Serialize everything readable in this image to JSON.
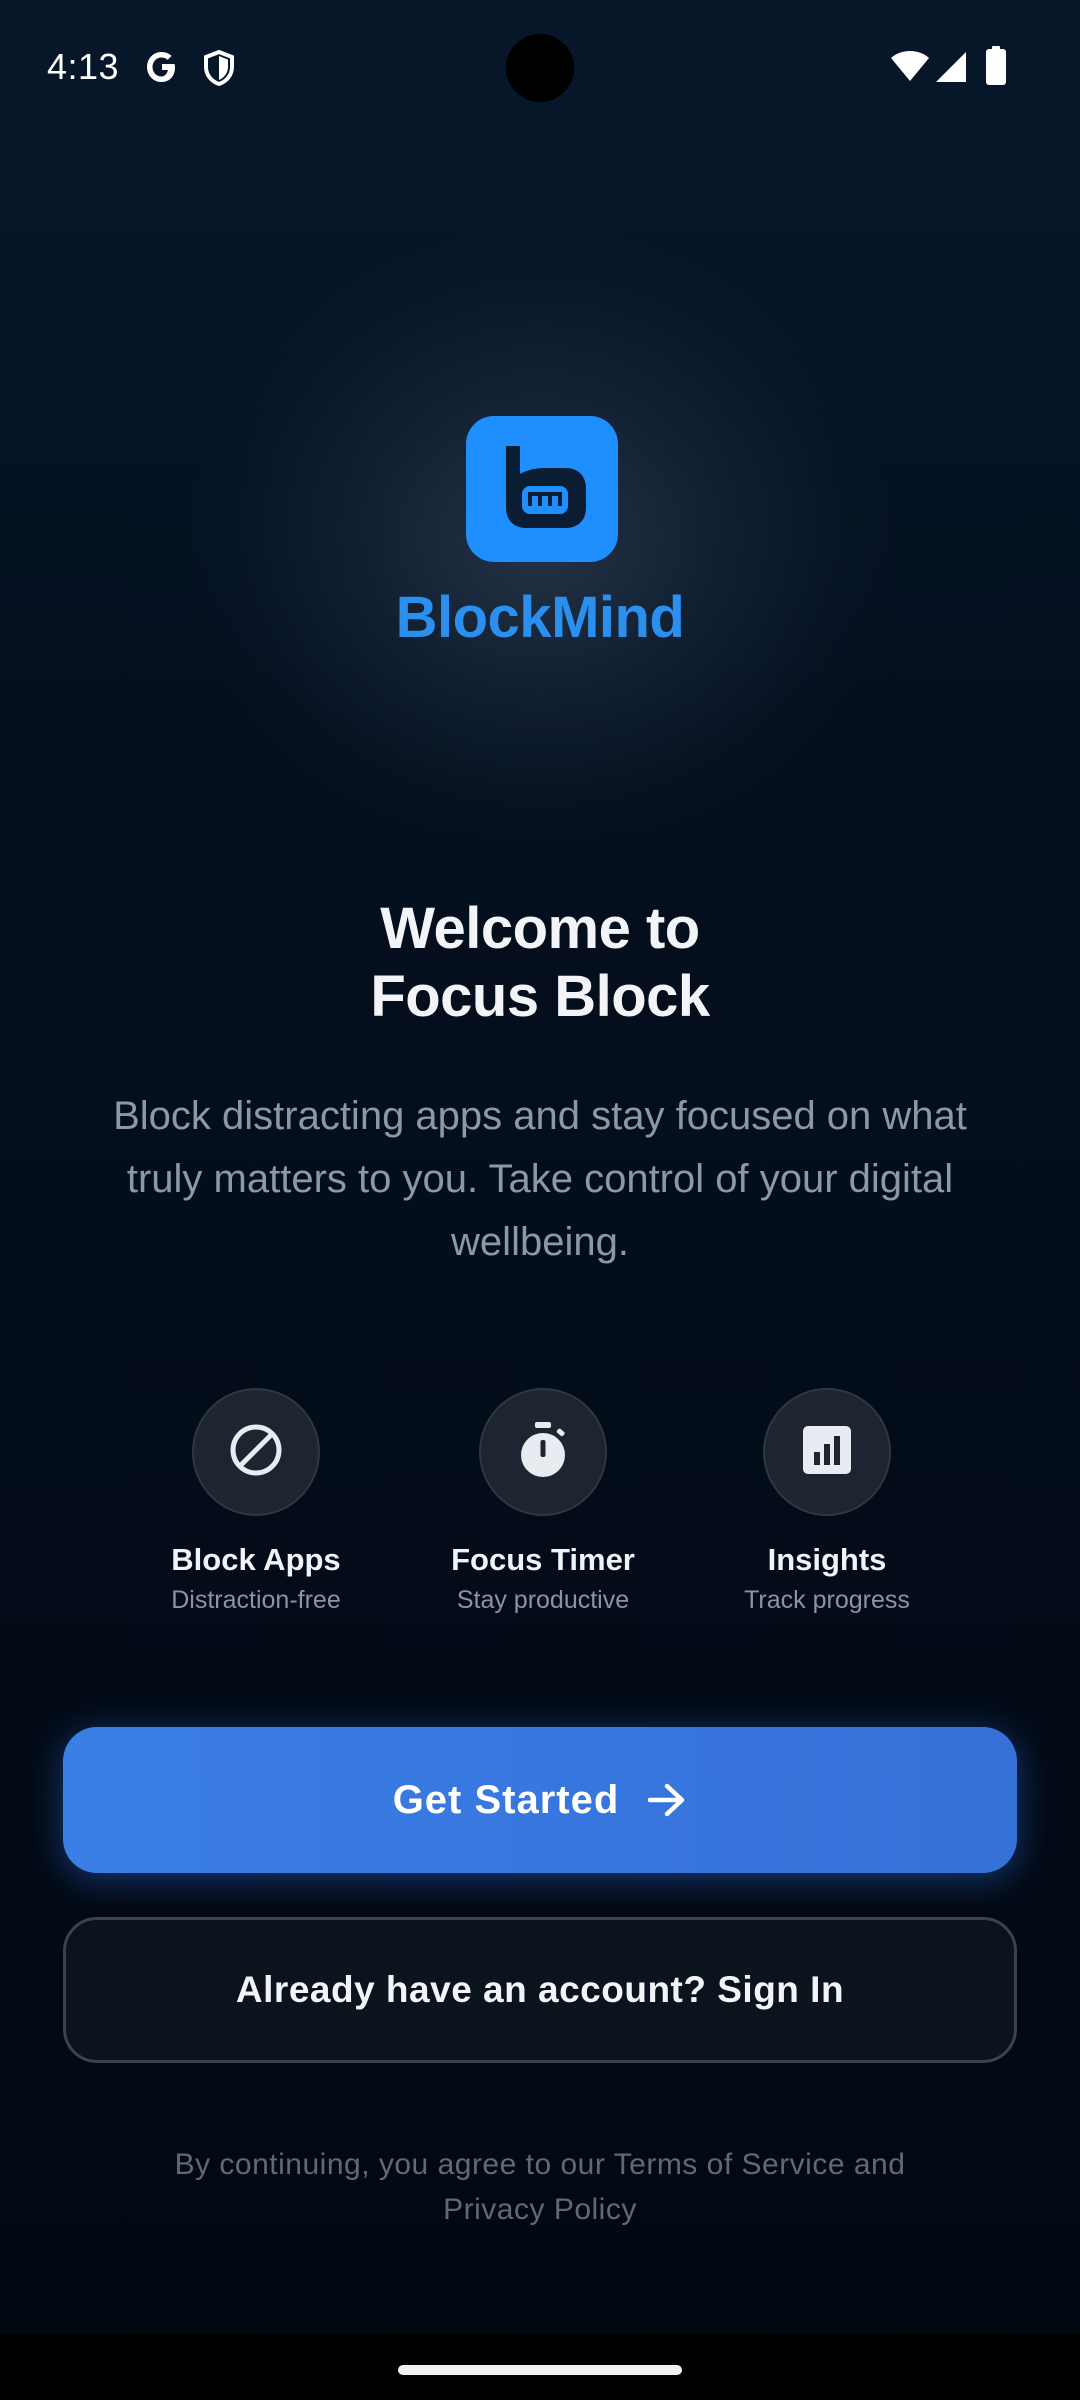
{
  "status_bar": {
    "time": "4:13",
    "left_icons": [
      "google-icon",
      "shield-icon"
    ],
    "right_icons": [
      "wifi-icon",
      "cellular-signal-icon",
      "battery-icon"
    ]
  },
  "logo": {
    "wordmark": "BlockMind",
    "tile_color": "#1f8fff",
    "wordmark_color": "#2b8ff0"
  },
  "welcome": {
    "title_line1": "Welcome to",
    "title_line2": "Focus Block",
    "description": "Block distracting apps and stay focused on what truly matters to you. Take control of your digital wellbeing."
  },
  "features": [
    {
      "icon": "block-icon",
      "title": "Block Apps",
      "subtitle": "Distraction-free"
    },
    {
      "icon": "timer-icon",
      "title": "Focus Timer",
      "subtitle": "Stay productive"
    },
    {
      "icon": "insights-chart-icon",
      "title": "Insights",
      "subtitle": "Track progress"
    }
  ],
  "buttons": {
    "primary_label": "Get Started",
    "primary_icon": "arrow-right-icon",
    "secondary_label": "Already have an account? Sign In"
  },
  "legal": "By continuing, you agree to our Terms of Service and Privacy Policy",
  "colors": {
    "background": "#040f1e",
    "primary_button": "#3776df",
    "accent": "#1f8fff"
  }
}
